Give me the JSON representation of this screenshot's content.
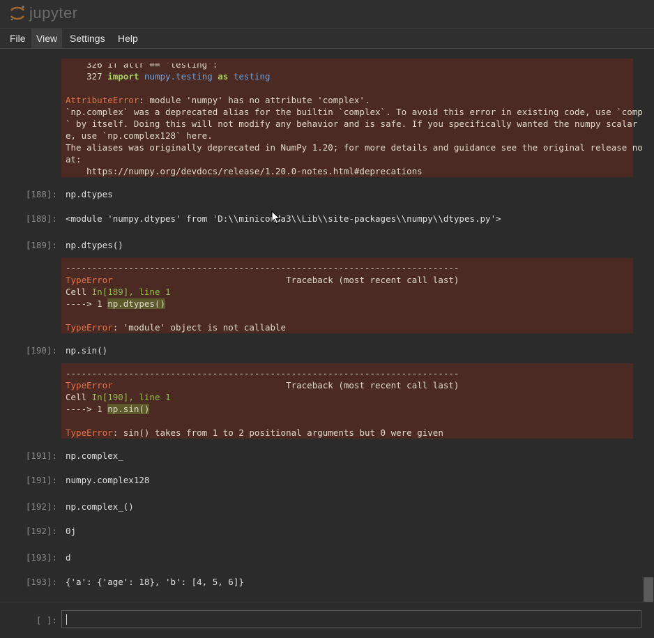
{
  "header": {
    "app_name": "jupyter"
  },
  "menu": [
    {
      "label": "File"
    },
    {
      "label": "View"
    },
    {
      "label": "Settings"
    },
    {
      "label": "Help"
    }
  ],
  "cells": {
    "top_error": {
      "line1": "    326 if attr == 'testing':",
      "line2_num": "    327 ",
      "line2_kw": "import",
      "line2_mod": "numpy.testing",
      "line2_as": "as",
      "line2_name": "testing",
      "ename": "AttributeError",
      "msg1": ": module 'numpy' has no attribute 'complex'.",
      "msg2": "`np.complex` was a deprecated alias for the builtin `complex`. To avoid this error in existing code, use `complex",
      "msg3": "` by itself. Doing this will not modify any behavior and is safe. If you specifically wanted the numpy scalar typ",
      "msg4": "e, use `np.complex128` here.",
      "msg5": "The aliases was originally deprecated in NumPy 1.20; for more details and guidance see the original release note",
      "msg6": "at:",
      "msg7": "    https://numpy.org/devdocs/release/1.20.0-notes.html#deprecations"
    },
    "c188_in": {
      "prompt": "[188]:",
      "code": "np.dtypes"
    },
    "c188_out": {
      "prompt": "[188]:",
      "text": "<module 'numpy.dtypes' from 'D:\\\\miniconda3\\\\Lib\\\\site-packages\\\\numpy\\\\dtypes.py'>"
    },
    "c189_in": {
      "prompt": "[189]:",
      "code": "np.dtypes()"
    },
    "c189_err": {
      "dashes": "---------------------------------------------------------------------------",
      "ename": "TypeError",
      "traceback": "                                 Traceback (most recent call last)",
      "cell_label": "Cell ",
      "cell_ref": "In[189], line 1",
      "arrow": "----> 1 ",
      "arrow_code": "np.dtypes()",
      "final_ename": "TypeError",
      "final_msg": ": 'module' object is not callable"
    },
    "c190_in": {
      "prompt": "[190]:",
      "code": "np.sin()"
    },
    "c190_err": {
      "dashes": "---------------------------------------------------------------------------",
      "ename": "TypeError",
      "traceback": "                                 Traceback (most recent call last)",
      "cell_label": "Cell ",
      "cell_ref": "In[190], line 1",
      "arrow": "----> 1 ",
      "arrow_code": "np.sin()",
      "final_ename": "TypeError",
      "final_msg": ": sin() takes from 1 to 2 positional arguments but 0 were given"
    },
    "c191_in": {
      "prompt": "[191]:",
      "code": "np.complex_"
    },
    "c191_out": {
      "prompt": "[191]:",
      "text": "numpy.complex128"
    },
    "c192_in": {
      "prompt": "[192]:",
      "code": "np.complex_()"
    },
    "c192_out": {
      "prompt": "[192]:",
      "text": "0j"
    },
    "c193_in": {
      "prompt": "[193]:",
      "code": "d"
    },
    "c193_out": {
      "prompt": "[193]:",
      "text": "{'a': {'age': 18}, 'b': [4, 5, 6]}"
    }
  },
  "input": {
    "prompt": "[ ]:",
    "value": ""
  },
  "colors": {
    "background": "#2b2b2b",
    "error_bg": "#4b2a23",
    "error_name": "#e0734a",
    "keyword": "#a8d05e",
    "module": "#6fa1d8"
  }
}
